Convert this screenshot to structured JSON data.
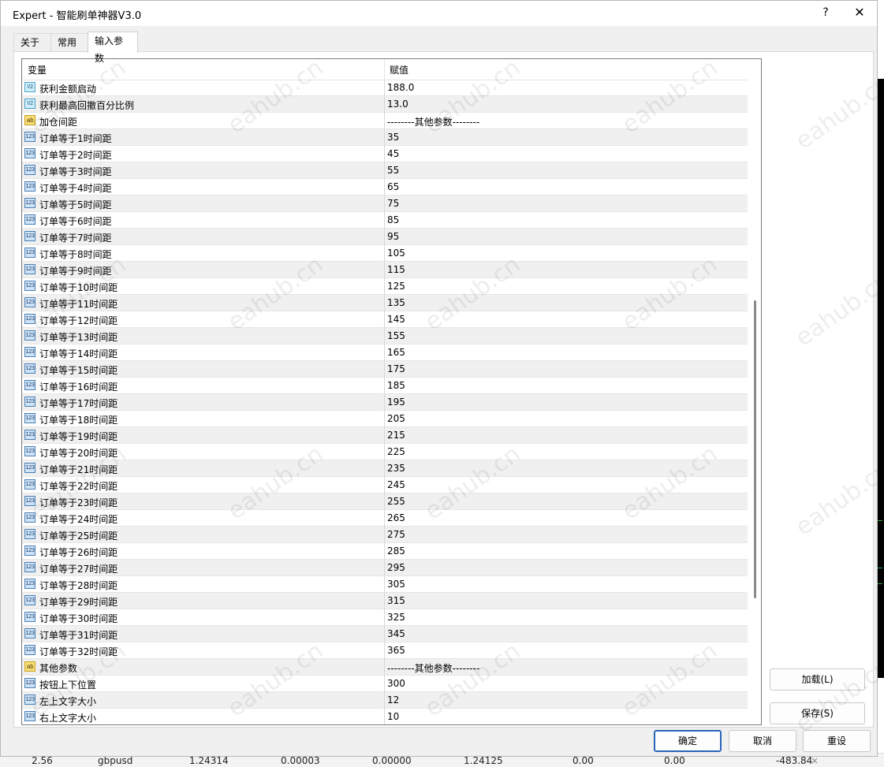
{
  "background": {
    "bottom_row": [
      "2.56",
      "gbpusd",
      "1.24314",
      "0.00003",
      "0.00000",
      "1.24125",
      "0.00",
      "0.00",
      "-483.84",
      "×"
    ]
  },
  "window": {
    "title": "Expert - 智能刷单神器V3.0",
    "help_icon": "?",
    "close_icon": "✕"
  },
  "tabs": [
    {
      "label": "关于"
    },
    {
      "label": "常用"
    },
    {
      "label": "输入参数"
    }
  ],
  "table": {
    "headers": {
      "variable": "变量",
      "value": "赋值"
    },
    "rows": [
      {
        "type": "double",
        "icon": "V2",
        "name": "获利金额启动",
        "value": "188.0"
      },
      {
        "type": "double",
        "icon": "V2",
        "name": "获利最高回撤百分比例",
        "value": "13.0"
      },
      {
        "type": "string",
        "icon": "ab",
        "name": "加仓间距",
        "value": "--------其他参数--------"
      },
      {
        "type": "int",
        "icon": "123",
        "name": "订单等于1时间距",
        "value": "35"
      },
      {
        "type": "int",
        "icon": "123",
        "name": "订单等于2时间距",
        "value": "45"
      },
      {
        "type": "int",
        "icon": "123",
        "name": "订单等于3时间距",
        "value": "55"
      },
      {
        "type": "int",
        "icon": "123",
        "name": "订单等于4时间距",
        "value": "65"
      },
      {
        "type": "int",
        "icon": "123",
        "name": "订单等于5时间距",
        "value": "75"
      },
      {
        "type": "int",
        "icon": "123",
        "name": "订单等于6时间距",
        "value": "85"
      },
      {
        "type": "int",
        "icon": "123",
        "name": "订单等于7时间距",
        "value": "95"
      },
      {
        "type": "int",
        "icon": "123",
        "name": "订单等于8时间距",
        "value": "105"
      },
      {
        "type": "int",
        "icon": "123",
        "name": "订单等于9时间距",
        "value": "115"
      },
      {
        "type": "int",
        "icon": "123",
        "name": "订单等于10时间距",
        "value": "125"
      },
      {
        "type": "int",
        "icon": "123",
        "name": "订单等于11时间距",
        "value": "135"
      },
      {
        "type": "int",
        "icon": "123",
        "name": "订单等于12时间距",
        "value": "145"
      },
      {
        "type": "int",
        "icon": "123",
        "name": "订单等于13时间距",
        "value": "155"
      },
      {
        "type": "int",
        "icon": "123",
        "name": "订单等于14时间距",
        "value": "165"
      },
      {
        "type": "int",
        "icon": "123",
        "name": "订单等于15时间距",
        "value": "175"
      },
      {
        "type": "int",
        "icon": "123",
        "name": "订单等于16时间距",
        "value": "185"
      },
      {
        "type": "int",
        "icon": "123",
        "name": "订单等于17时间距",
        "value": "195"
      },
      {
        "type": "int",
        "icon": "123",
        "name": "订单等于18时间距",
        "value": "205"
      },
      {
        "type": "int",
        "icon": "123",
        "name": "订单等于19时间距",
        "value": "215"
      },
      {
        "type": "int",
        "icon": "123",
        "name": "订单等于20时间距",
        "value": "225"
      },
      {
        "type": "int",
        "icon": "123",
        "name": "订单等于21时间距",
        "value": "235"
      },
      {
        "type": "int",
        "icon": "123",
        "name": "订单等于22时间距",
        "value": "245"
      },
      {
        "type": "int",
        "icon": "123",
        "name": "订单等于23时间距",
        "value": "255"
      },
      {
        "type": "int",
        "icon": "123",
        "name": "订单等于24时间距",
        "value": "265"
      },
      {
        "type": "int",
        "icon": "123",
        "name": "订单等于25时间距",
        "value": "275"
      },
      {
        "type": "int",
        "icon": "123",
        "name": "订单等于26时间距",
        "value": "285"
      },
      {
        "type": "int",
        "icon": "123",
        "name": "订单等于27时间距",
        "value": "295"
      },
      {
        "type": "int",
        "icon": "123",
        "name": "订单等于28时间距",
        "value": "305"
      },
      {
        "type": "int",
        "icon": "123",
        "name": "订单等于29时间距",
        "value": "315"
      },
      {
        "type": "int",
        "icon": "123",
        "name": "订单等于30时间距",
        "value": "325"
      },
      {
        "type": "int",
        "icon": "123",
        "name": "订单等于31时间距",
        "value": "345"
      },
      {
        "type": "int",
        "icon": "123",
        "name": "订单等于32时间距",
        "value": "365"
      },
      {
        "type": "string",
        "icon": "ab",
        "name": "其他参数",
        "value": "--------其他参数--------"
      },
      {
        "type": "int",
        "icon": "123",
        "name": "按钮上下位置",
        "value": "300"
      },
      {
        "type": "int",
        "icon": "123",
        "name": "左上文字大小",
        "value": "12"
      },
      {
        "type": "int",
        "icon": "123",
        "name": "右上文字大小",
        "value": "10"
      }
    ]
  },
  "side_buttons": {
    "load": "加载(L)",
    "save": "保存(S)"
  },
  "footer_buttons": {
    "ok": "确定",
    "cancel": "取消",
    "reset": "重设"
  },
  "watermark": "eahub.cn"
}
